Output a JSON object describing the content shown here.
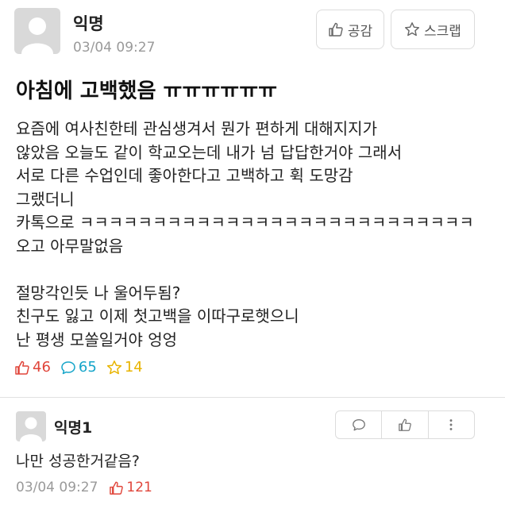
{
  "post": {
    "author": "익명",
    "date": "03/04 09:27",
    "like_button_label": "공감",
    "scrap_button_label": "스크랩",
    "title": "아침에 고백했음 ㅠㅠㅠㅠㅠㅠ",
    "body_lines": [
      "요즘에 여사친한테 관심생겨서 뭔가 편하게 대해지지가",
      "않았음 오늘도 같이 학교오는데 내가 넘 답답한거야 그래서",
      "서로 다른 수업인데 좋아한다고 고백하고 휙 도망감",
      "그랬더니",
      "카톡으로 ㅋㅋㅋㅋㅋㅋㅋㅋㅋㅋㅋㅋㅋㅋㅋㅋㅋㅋㅋㅋㅋㅋㅋㅋㅋㅋㅋ",
      "오고 아무말없음",
      "",
      "절망각인듯 나 울어두됨?",
      "친구도 잃고 이제 첫고백을 이따구로햇으니",
      "난 평생 모쏠일거야 엉엉"
    ],
    "stats": {
      "likes": "46",
      "comments": "65",
      "scraps": "14"
    }
  },
  "comment": {
    "author": "익명1",
    "text": "나만 성공한거같음?",
    "date": "03/04 09:27",
    "likes": "121"
  },
  "colors": {
    "like": "#e0453a",
    "comment": "#16a5c9",
    "scrap": "#e8b400",
    "meta": "#9a9a9a"
  }
}
